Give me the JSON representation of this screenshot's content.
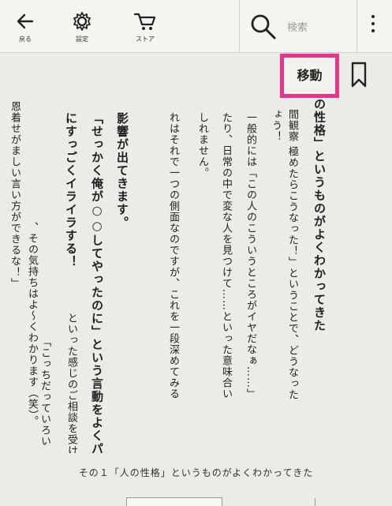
{
  "toolbar": {
    "back_label": "戻る",
    "settings_label": "設定",
    "store_label": "ストア",
    "search_placeholder": "検索"
  },
  "jump_label": "移動",
  "columns": [
    {
      "text": "の性格」というものがよくわかってきた",
      "bold": true
    },
    {
      "text": "間観察 極めたらこうなった！」ということで、どうなった",
      "bold": false
    },
    {
      "text": "ょう！",
      "bold": false
    },
    {
      "text": "一般的には「この人のこういうところがイヤだなぁ……」",
      "bold": false
    },
    {
      "text": "たり、日常の中で変な人を見つけて……といった意味合い",
      "bold": false
    },
    {
      "text": "しれません。",
      "bold": false
    },
    {
      "text": "れはそれで一つの側面なのですが、これを一段深めてみる",
      "bold": false
    },
    {
      "text": "影響が出てきます。",
      "bold": true
    },
    {
      "text": "「せっかく俺が○○してやったのに」という言動をよくパ",
      "bold": true
    },
    {
      "text": "にすっごくイライラする！",
      "bold": true
    },
    {
      "text": "といった感じのご相談を受け",
      "bold": false
    },
    {
      "text": "「こっちだっていろい",
      "bold": false
    },
    {
      "text": "、その気持ちはよ〜くわかります（笑）。",
      "bold": false
    },
    {
      "text": "う言い方ができるな！」",
      "bold": false
    },
    {
      "text": "せがましい言い方ができるな！」",
      "bold": false
    },
    {
      "text": "恩着せがましい言い方ができるな！」",
      "bold": false
    }
  ],
  "footer_title": "その１「人の性格」というものがよくわかってきた"
}
